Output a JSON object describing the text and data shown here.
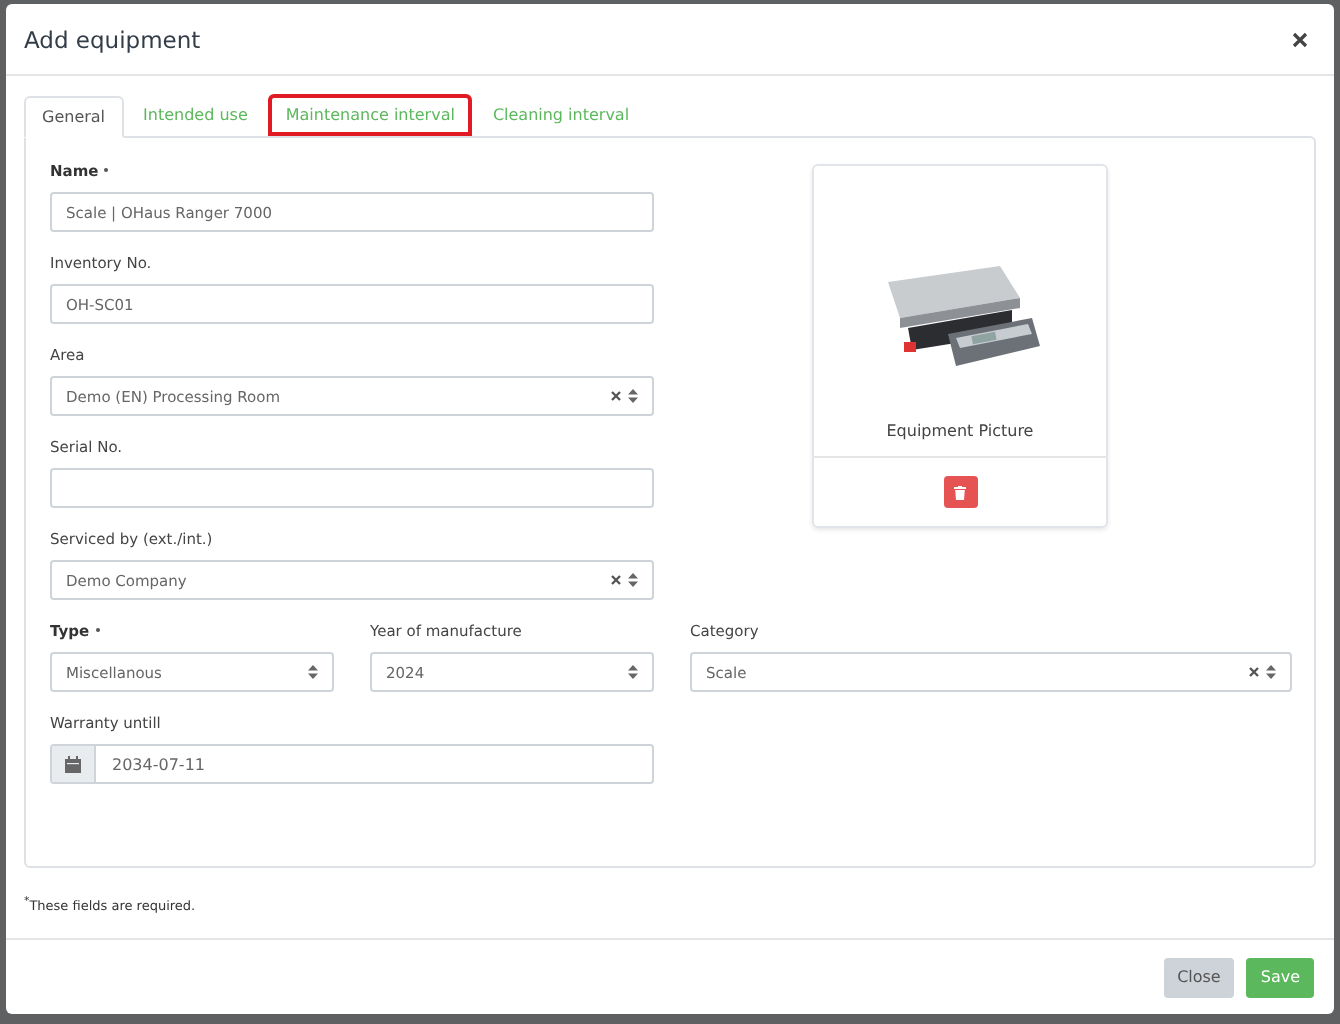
{
  "dialog": {
    "title": "Add equipment"
  },
  "tabs": [
    {
      "label": "General",
      "selected": true,
      "highlighted": false
    },
    {
      "label": "Intended use",
      "selected": false,
      "highlighted": false
    },
    {
      "label": "Maintenance interval",
      "selected": false,
      "highlighted": true
    },
    {
      "label": "Cleaning interval",
      "selected": false,
      "highlighted": false
    }
  ],
  "left_fields": [
    {
      "label": "Name",
      "required": true,
      "kind": "text",
      "value": "Scale | OHaus Ranger 7000"
    },
    {
      "label": "Inventory No.",
      "required": false,
      "kind": "text",
      "value": "OH-SC01"
    },
    {
      "label": "Area",
      "required": false,
      "kind": "select",
      "clearable": true,
      "value": "Demo (EN) Processing Room"
    },
    {
      "label": "Serial No.",
      "required": false,
      "kind": "text"
    },
    {
      "label": "Serviced by (ext./int.)",
      "required": false,
      "kind": "select",
      "clearable": true,
      "value": "Demo Company"
    }
  ],
  "row_fields": [
    {
      "label": "Type",
      "required": true,
      "kind": "select",
      "clearable": false,
      "value": "Miscellanous"
    },
    {
      "label": "Year of manufacture",
      "required": false,
      "kind": "select",
      "clearable": false,
      "value": "2024"
    },
    {
      "label": "Category",
      "required": false,
      "kind": "select",
      "clearable": true,
      "value": "Scale"
    }
  ],
  "warranty": {
    "label": "Warranty untill",
    "required": false,
    "kind": "date",
    "value": "2034-07-11"
  },
  "picture": {
    "caption": "Equipment Picture"
  },
  "footnote": "$^{*}$These fields are required.",
  "buttons": [
    {
      "label": "Close",
      "kind": "secondary"
    },
    {
      "label": "Save",
      "kind": "primary"
    }
  ]
}
